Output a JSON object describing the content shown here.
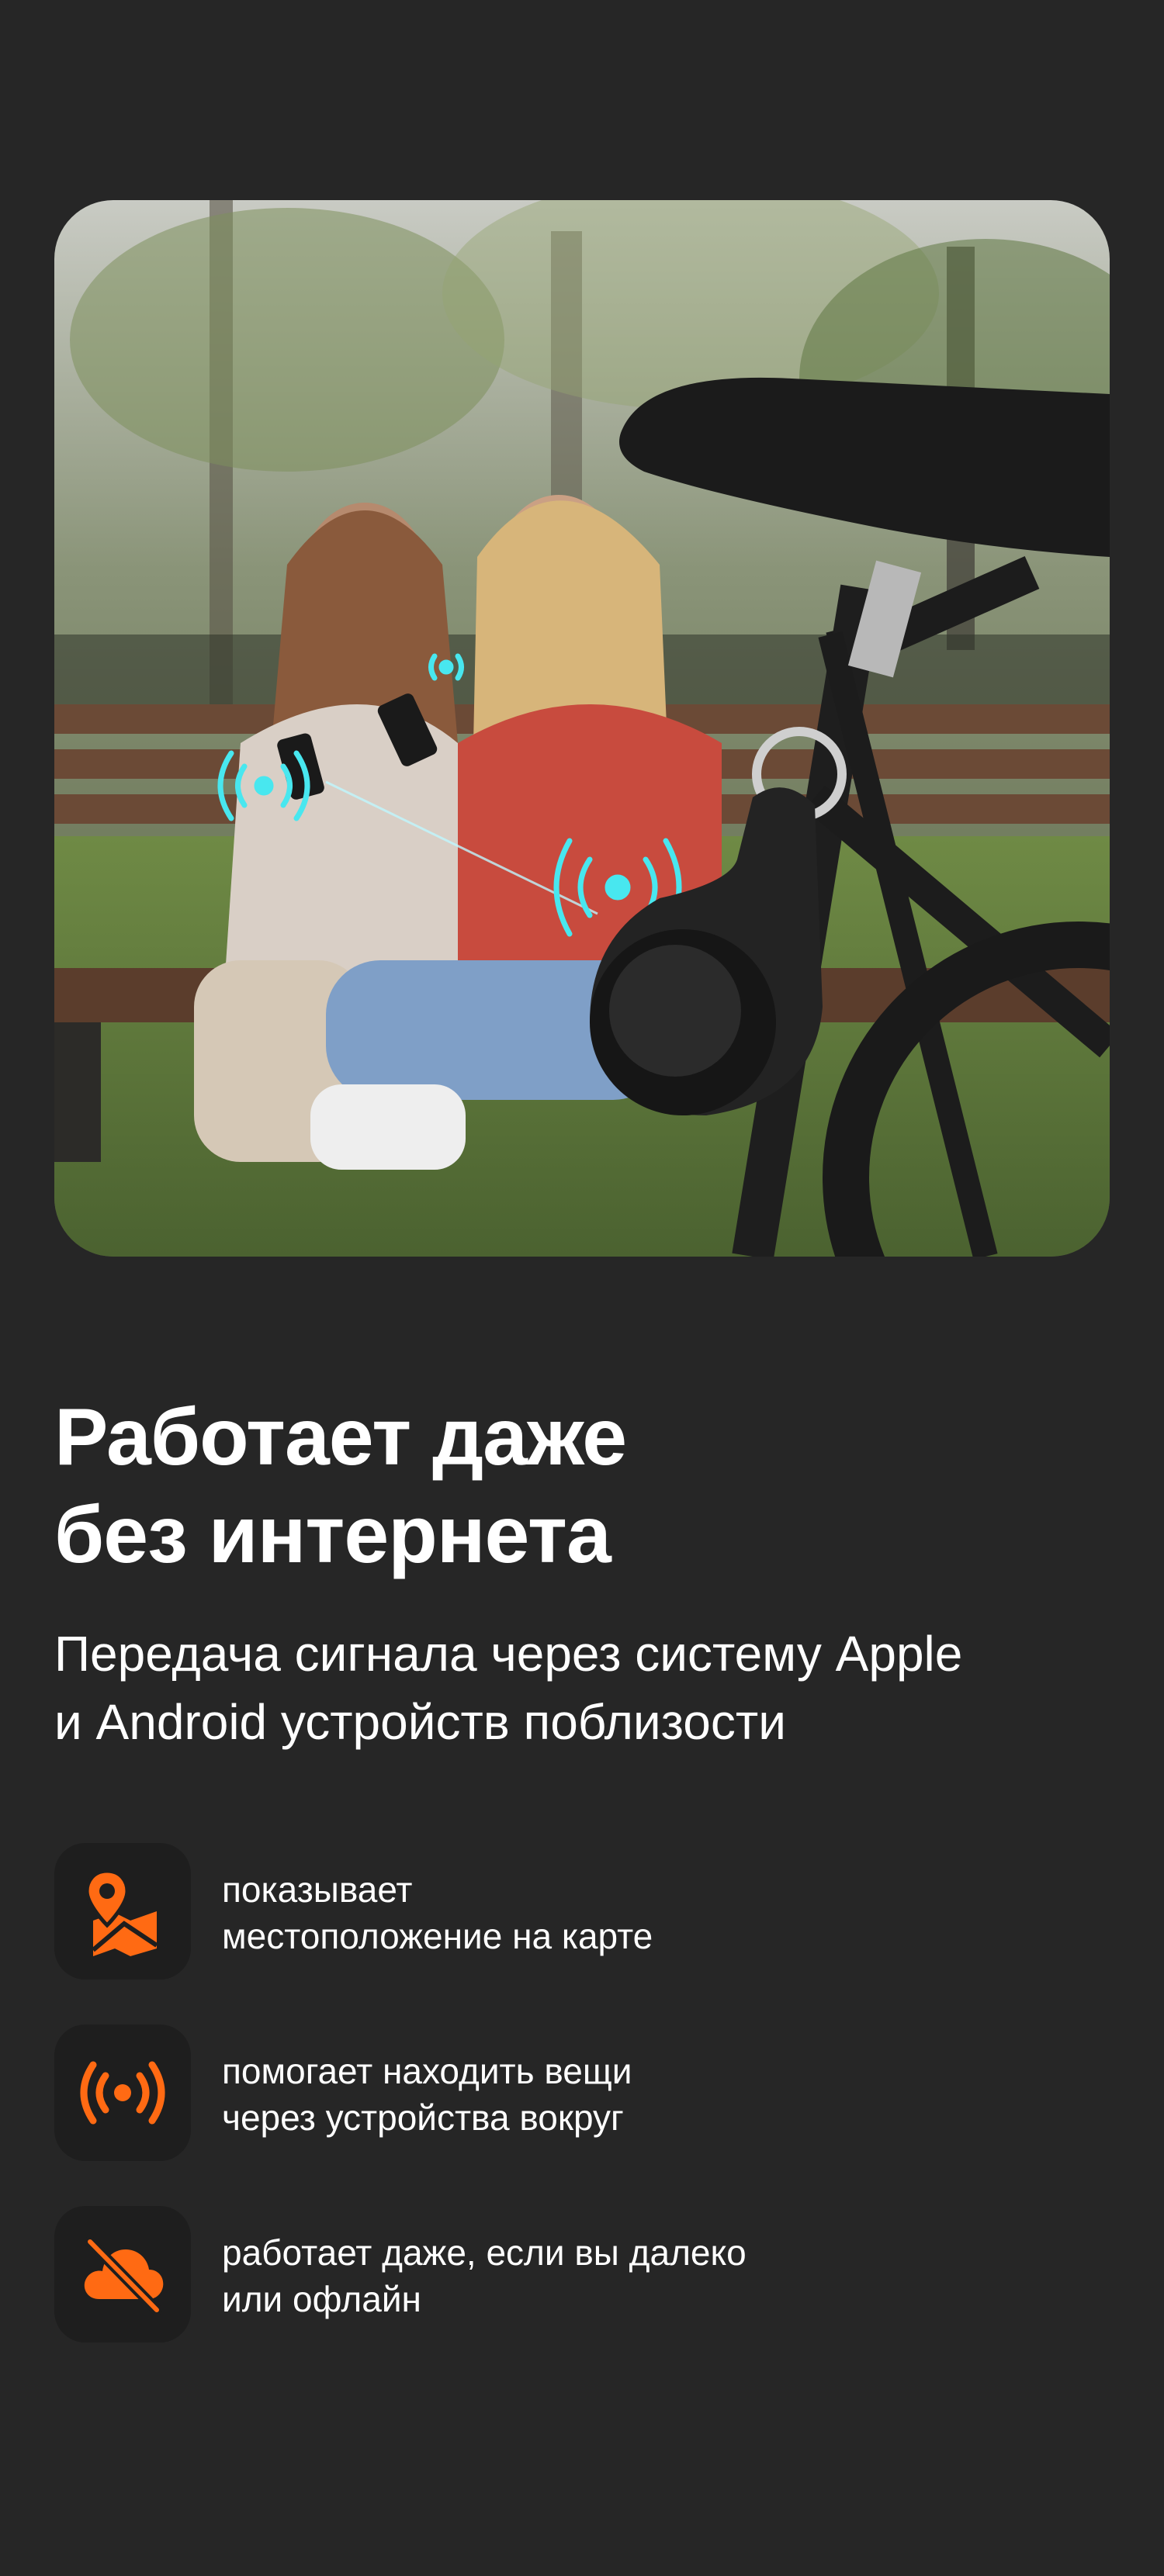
{
  "hero_image": {
    "description_icon": "photo-icon"
  },
  "headline": {
    "line1": "Работает даже",
    "line2": "без интернета"
  },
  "subtitle": {
    "line1": "Передача сигнала через систему Apple",
    "line2": "и Android устройств поблизости"
  },
  "features": [
    {
      "icon": "map-pin-icon",
      "line1": "показывает",
      "line2": "местоположение на карте"
    },
    {
      "icon": "signal-broadcast-icon",
      "line1": "помогает находить вещи",
      "line2": "через устройства вокруг"
    },
    {
      "icon": "cloud-off-icon",
      "line1": "работает даже, если вы далеко",
      "line2": "или офлайн"
    }
  ],
  "colors": {
    "background": "#262626",
    "accent": "#ff6a13",
    "signal": "#3de0e8",
    "text": "#ffffff"
  }
}
